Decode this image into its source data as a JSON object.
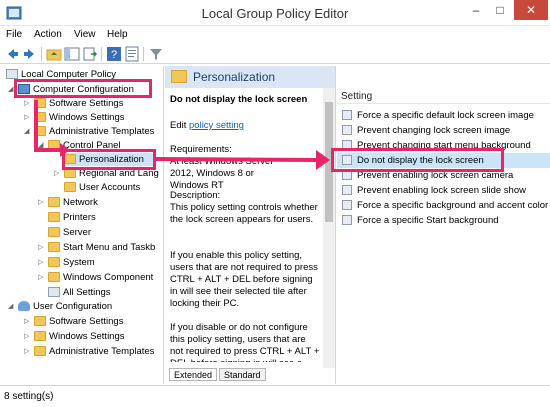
{
  "window": {
    "title": "Local Group Policy Editor",
    "minimize": "–",
    "maximize": "□",
    "close": "✕"
  },
  "menu": [
    "File",
    "Action",
    "View",
    "Help"
  ],
  "tree": {
    "root": "Local Computer Policy",
    "items": [
      {
        "label": "Computer Configuration"
      },
      {
        "label": "Software Settings"
      },
      {
        "label": "Windows Settings"
      },
      {
        "label": "Administrative Templates"
      },
      {
        "label": "Control Panel"
      },
      {
        "label": "Personalization"
      },
      {
        "label": "Regional and Lang"
      },
      {
        "label": "User Accounts"
      },
      {
        "label": "Network"
      },
      {
        "label": "Printers"
      },
      {
        "label": "Server"
      },
      {
        "label": "Start Menu and Taskb"
      },
      {
        "label": "System"
      },
      {
        "label": "Windows Component"
      },
      {
        "label": "All Settings"
      },
      {
        "label": "User Configuration"
      },
      {
        "label": "Software Settings"
      },
      {
        "label": "Windows Settings"
      },
      {
        "label": "Administrative Templates"
      }
    ]
  },
  "middle": {
    "header": "Personalization",
    "policy_title": "Do not display the lock screen",
    "edit_prefix": "Edit",
    "edit_link": "policy setting",
    "requirements_label": "Requirements:",
    "requirements_value": "At least Windows Server 2012, Windows 8 or Windows RT",
    "description_label": "Description:",
    "description_1": "This policy setting controls whether the lock screen appears for users.",
    "description_2": "If you enable this policy setting, users that are not required to press CTRL + ALT + DEL before signing in will see their selected tile after locking their PC.",
    "description_3": "If you disable or do not configure this policy setting, users that are not required to press CTRL + ALT + DEL before signing in will see a"
  },
  "tabs": [
    "Extended",
    "Standard"
  ],
  "right": {
    "column_header": "Setting",
    "settings": [
      "Force a specific default lock screen image",
      "Prevent changing lock screen image",
      "Prevent changing start menu background",
      "Do not display the lock screen",
      "Prevent enabling lock screen camera",
      "Prevent enabling lock screen slide show",
      "Force a specific background and accent color",
      "Force a specific Start background"
    ]
  },
  "status": "8 setting(s)",
  "colors": {
    "highlight": "#e8256a",
    "selection": "#cce4f7",
    "header": "#dbe6f4"
  }
}
